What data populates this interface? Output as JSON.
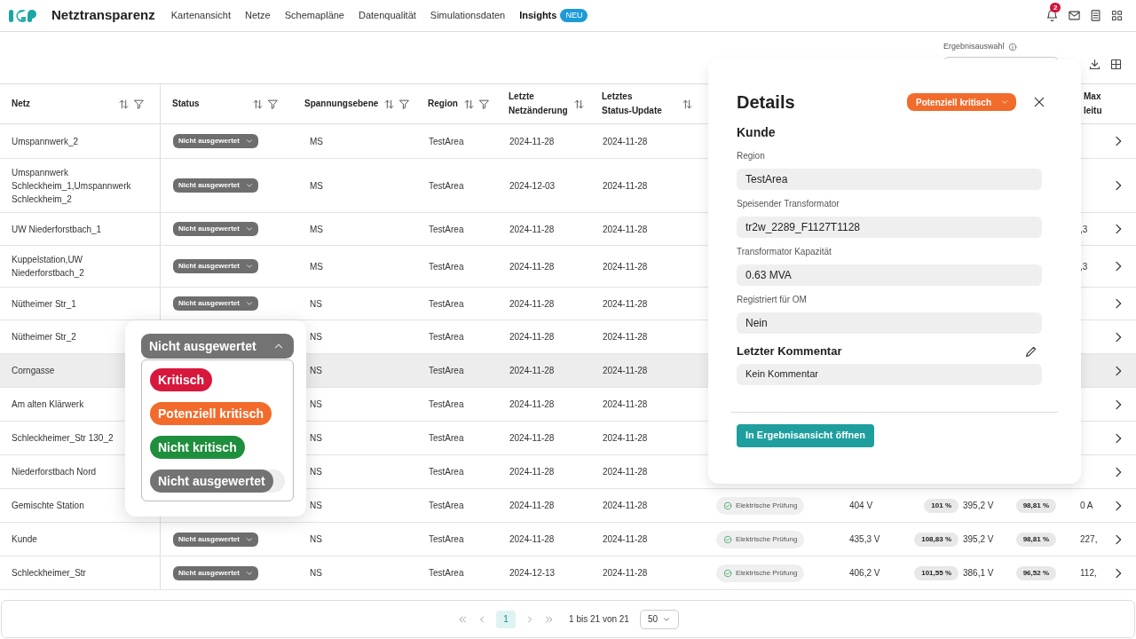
{
  "nav": {
    "title": "Netztransparenz",
    "links": [
      {
        "label": "Kartenansicht",
        "selected": false
      },
      {
        "label": "Netze",
        "selected": false
      },
      {
        "label": "Schemapläne",
        "selected": false
      },
      {
        "label": "Datenqualität",
        "selected": false
      },
      {
        "label": "Simulationsdaten",
        "selected": false
      },
      {
        "label": "Insights",
        "selected": true,
        "badge": "NEU"
      }
    ],
    "notification_count": "2"
  },
  "toolbar": {
    "result_selection_label": "Ergebnisauswahl"
  },
  "table": {
    "columns": [
      {
        "label": "Netz",
        "sortable": true,
        "filterable": true
      },
      {
        "label": "Status",
        "sortable": true,
        "filterable": true
      },
      {
        "label": "Spannungsebene",
        "sortable": true,
        "filterable": true
      },
      {
        "label": "Region",
        "sortable": true,
        "filterable": true
      },
      {
        "label": "Letzte Netzänderung",
        "sortable": true,
        "filterable": false
      },
      {
        "label": "Letztes Status-Update",
        "sortable": true,
        "filterable": false
      },
      {
        "label": "Max leitu"
      }
    ],
    "rows": [
      {
        "netz": "Umspannwerk_2",
        "status": "Nicht ausgewertet",
        "voltage_level": "MS",
        "region": "TestArea",
        "last_change": "2024-11-28",
        "last_status_update": "2024-11-28",
        "selected": false
      },
      {
        "netz": "Umspannwerk Schleckheim_1,Umspannwerk Schleckheim_2",
        "status": "Nicht ausgewertet",
        "voltage_level": "MS",
        "region": "TestArea",
        "last_change": "2024-12-03",
        "last_status_update": "2024-11-28",
        "selected": false
      },
      {
        "netz": "UW Niederforstbach_1",
        "status": "Nicht ausgewertet",
        "voltage_level": "MS",
        "region": "TestArea",
        "last_change": "2024-11-28",
        "last_status_update": "2024-11-28",
        "column_12": ",3",
        "selected": false
      },
      {
        "netz": "Kuppelstation,UW Niederforstbach_2",
        "status": "Nicht ausgewertet",
        "voltage_level": "MS",
        "region": "TestArea",
        "last_change": "2024-11-28",
        "last_status_update": "2024-11-28",
        "column_12": ",3",
        "selected": false
      },
      {
        "netz": "Nütheimer Str_1",
        "status": "Nicht ausgewertet",
        "voltage_level": "NS",
        "region": "TestArea",
        "last_change": "2024-11-28",
        "last_status_update": "2024-11-28",
        "selected": false
      },
      {
        "netz": "Nütheimer Str_2",
        "voltage_level": "NS",
        "region": "TestArea",
        "last_change": "2024-11-28",
        "last_status_update": "2024-11-28",
        "selected": false
      },
      {
        "netz": "Corngasse",
        "voltage_level": "NS",
        "region": "TestArea",
        "last_change": "2024-11-28",
        "last_status_update": "2024-11-28",
        "selected": true
      },
      {
        "netz": "Am alten Klärwerk",
        "voltage_level": "NS",
        "region": "TestArea",
        "last_change": "2024-11-28",
        "last_status_update": "2024-11-28",
        "selected": false
      },
      {
        "netz": "Schleckheimer_Str 130_2",
        "voltage_level": "NS",
        "region": "TestArea",
        "last_change": "2024-11-28",
        "last_status_update": "2024-11-28",
        "selected": false
      },
      {
        "netz": "Niederforstbach Nord",
        "voltage_level": "NS",
        "region": "TestArea",
        "last_change": "2024-11-28",
        "last_status_update": "2024-11-28",
        "selected": false
      },
      {
        "netz": "Gemischte Station",
        "voltage_level": "NS",
        "region": "TestArea",
        "last_change": "2024-11-28",
        "last_status_update": "2024-11-28",
        "column_7": "Elektrische Prüfung",
        "column_8": "404 V",
        "column_9": "101 %",
        "column_10": "395,2 V",
        "column_11": "98,81 %",
        "column_12": "0 A",
        "selected": false
      },
      {
        "netz": "Kunde",
        "status": "Nicht ausgewertet",
        "voltage_level": "NS",
        "region": "TestArea",
        "last_change": "2024-11-28",
        "last_status_update": "2024-11-28",
        "column_7": "Elektrische Prüfung",
        "column_8": "435,3 V",
        "column_9": "108,83 %",
        "column_10": "395,2 V",
        "column_11": "98,81 %",
        "column_12": "227,",
        "selected": false
      },
      {
        "netz": "Schleckheimer_Str",
        "status": "Nicht ausgewertet",
        "voltage_level": "NS",
        "region": "TestArea",
        "last_change": "2024-12-13",
        "last_status_update": "2024-11-28",
        "column_7": "Elektrische Prüfung",
        "column_8": "406,2 V",
        "column_9": "101,55 %",
        "column_10": "386,1 V",
        "column_11": "96,52 %",
        "column_12": "112,",
        "selected": false
      }
    ]
  },
  "status_menu": {
    "current": "Nicht ausgewertet",
    "expanded": true,
    "options": [
      {
        "label": "Kritisch",
        "color": "#d8173c",
        "selected": false
      },
      {
        "label": "Potenziell kritisch",
        "color": "#f26b2b",
        "selected": false
      },
      {
        "label": "Nicht kritisch",
        "color": "#1e8f3c",
        "selected": false
      },
      {
        "label": "Nicht ausgewertet",
        "color": "#737373",
        "selected": true
      }
    ]
  },
  "details": {
    "title": "Details",
    "status": {
      "label": "Potenziell kritisch",
      "color": "#f26b2b"
    },
    "section": "Kunde",
    "fields": [
      {
        "label": "Region",
        "value": "TestArea"
      },
      {
        "label": "Speisender Transformator",
        "value": "tr2w_2289_F1127T1128"
      },
      {
        "label": "Transformator Kapazität",
        "value": "0.63 MVA"
      },
      {
        "label": "Registriert für OM",
        "value": "Nein"
      }
    ],
    "comment_title": "Letzter Kommentar",
    "comment": "Kein Kommentar",
    "action": "In Ergebnisansicht öffnen"
  },
  "pagination": {
    "pages": [
      {
        "label": "1",
        "selected": true
      }
    ],
    "range": "1 bis 21 von 21",
    "page_size": "50"
  }
}
